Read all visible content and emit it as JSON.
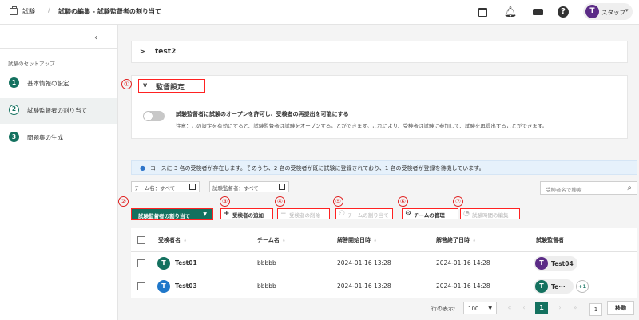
{
  "header": {
    "breadcrumb_root": "試験",
    "breadcrumb_sep": "/",
    "breadcrumb_current": "試験の編集 - 試験監督者の割り当て",
    "user_initial": "T",
    "user_name": "スタッフ",
    "icons": [
      "briefcase-icon",
      "calendar-icon",
      "bell-icon",
      "car-icon",
      "help-icon",
      "chevron-down-icon"
    ]
  },
  "sidebar": {
    "collapse_glyph": "‹",
    "section_title": "試験のセットアップ",
    "steps": [
      {
        "num": "1",
        "label": "基本情報の設定"
      },
      {
        "num": "2",
        "label": "試験監督者の割り当て"
      },
      {
        "num": "3",
        "label": "問題集の生成"
      }
    ]
  },
  "main": {
    "test_card": {
      "chevron": ">",
      "title": "test2"
    },
    "proctor_settings": {
      "chevron": "v",
      "title": "監督設定",
      "toggle_label": "試験監督者に試験のオープンを許可し、受検者の再提出を可能にする",
      "toggle_note": "注意：この設定を有効にすると、試験監督者は試験をオープンすることができます。これにより、受検者は試験に参加して、試験を再提出することができます。",
      "toggle_on": false
    },
    "info": {
      "text": "コースに 3 名の受検者が存在します。そのうち、2 名の受検者が既に試験に登録されており、1 名の受検者が登録を待機しています。"
    },
    "filters": {
      "team": "チーム名：すべて",
      "proctor": "試験監督者：すべて",
      "search_placeholder": "受検者名で検索"
    },
    "actions": {
      "assign": "試験監督者の割り当て",
      "add": "受検者の追加",
      "remove": "受検者の削除",
      "assign_team": "チームの割り当て",
      "manage_team": "チームの管理",
      "edit_time": "試験時間の編集"
    },
    "markers": [
      "①",
      "②",
      "③",
      "④",
      "⑤",
      "⑥",
      "⑦"
    ],
    "table": {
      "columns": [
        "受検者名",
        "チーム名",
        "解答開始日時",
        "解答終了日時",
        "試験監督者"
      ],
      "rows": [
        {
          "initial": "T",
          "name": "Test01",
          "team": "bbbbb",
          "start": "2024-01-16 13:28",
          "end": "2024-01-16 14:28",
          "proctor_initial": "T",
          "proctor": "Test04",
          "extra": ""
        },
        {
          "initial": "T",
          "name": "Test03",
          "team": "bbbbb",
          "start": "2024-01-16 13:28",
          "end": "2024-01-16 14:28",
          "proctor_initial": "T",
          "proctor": "Te···",
          "extra": "+1"
        }
      ]
    },
    "pagination": {
      "rows_label": "行の表示:",
      "page_size": "100",
      "current_page": "1",
      "goto_value": "1",
      "goto_button": "移動"
    }
  },
  "colors": {
    "accent": "#14715f",
    "annotation": "#ff2222",
    "info_bg": "#e6f1fb",
    "purple_avatar": "#5b2b86",
    "blue_avatar": "#1f77c9"
  }
}
